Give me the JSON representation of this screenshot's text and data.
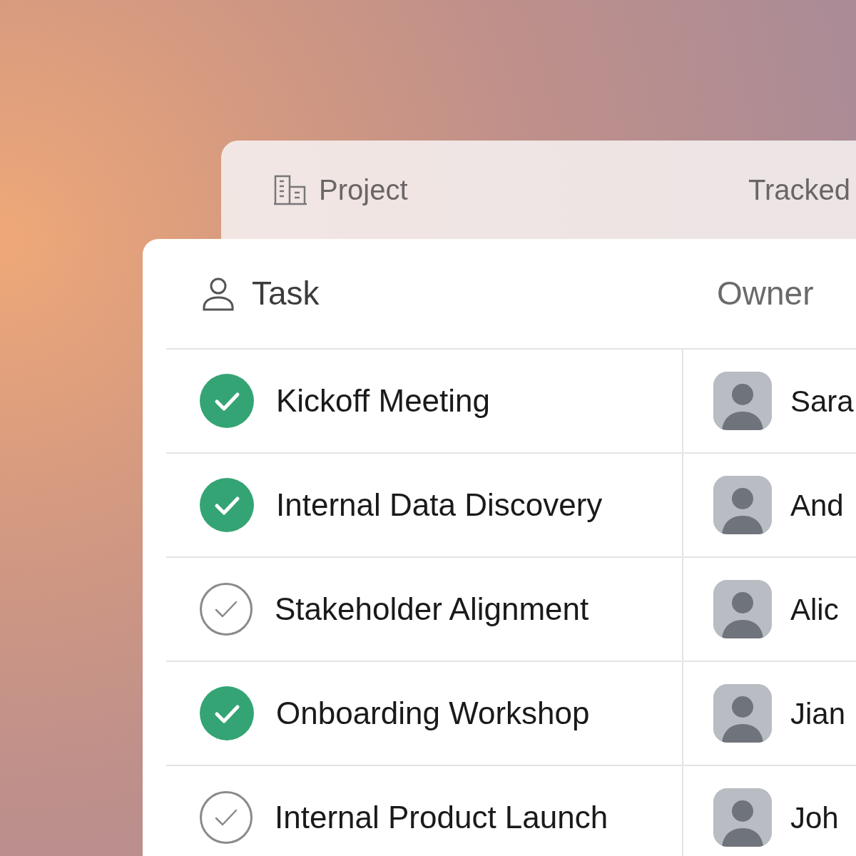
{
  "back_header": {
    "columns": [
      {
        "label": "Project"
      },
      {
        "label": "Tracked"
      }
    ]
  },
  "table": {
    "columns": [
      {
        "label": "Task"
      },
      {
        "label": "Owner"
      }
    ],
    "rows": [
      {
        "task": "Kickoff Meeting",
        "checked": true,
        "owner": "Sara"
      },
      {
        "task": "Internal Data Discovery",
        "checked": true,
        "owner": "And"
      },
      {
        "task": "Stakeholder Alignment",
        "checked": false,
        "owner": "Alic"
      },
      {
        "task": "Onboarding Workshop",
        "checked": true,
        "owner": "Jian"
      },
      {
        "task": "Internal Product Launch",
        "checked": false,
        "owner": "Joh"
      }
    ]
  }
}
